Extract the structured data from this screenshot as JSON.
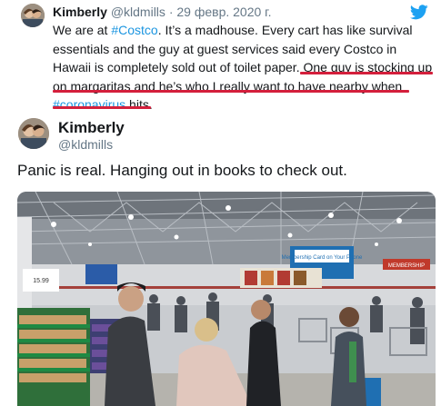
{
  "quoted_tweet": {
    "name": "Kimberly",
    "handle": "@kldmills",
    "separator": "·",
    "date": "29 февр. 2020 г.",
    "text_part1": "We are at ",
    "hashtag1": "#Costco",
    "text_part2": ". It’s a madhouse. Every cart has like survival essentials and the guy at guest services said every Costco in Hawaii is completely sold out of toilet paper. ",
    "highlight_part1": "One guy is stocking up on margaritas and he’s who I really want to have nearby when ",
    "hashtag2": "#coronavirus",
    "highlight_part2": " hits.",
    "highlight_color": "#d41f3c",
    "link_color": "#1b95e0"
  },
  "main_tweet": {
    "name": "Kimberly",
    "handle": "@kldmills",
    "text": "Panic is real. Hanging out in books to check out."
  },
  "icons": {
    "service_logo": "twitter-bird-icon"
  },
  "photo": {
    "subject": "store-checkout-line",
    "signs": {
      "membership": "Membership Card on Your Phone",
      "right_sign": "MEMBERSHIP",
      "pillar_price": "15.99"
    }
  },
  "colors": {
    "text": "#14171a",
    "secondary": "#657786",
    "twitter_blue": "#1da1f2"
  }
}
